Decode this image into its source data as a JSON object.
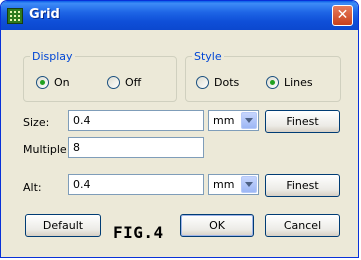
{
  "window": {
    "title": "Grid",
    "close_glyph": "✕"
  },
  "display_group": {
    "label": "Display",
    "options": [
      {
        "label": "On",
        "checked": true
      },
      {
        "label": "Off",
        "checked": false
      }
    ]
  },
  "style_group": {
    "label": "Style",
    "options": [
      {
        "label": "Dots",
        "checked": false
      },
      {
        "label": "Lines",
        "checked": true
      }
    ]
  },
  "size": {
    "label": "Size:",
    "value": "0.4",
    "unit": "mm",
    "button": "Finest"
  },
  "multiple": {
    "label": "Multiple:",
    "value": "8"
  },
  "alt": {
    "label": "Alt:",
    "value": "0.4",
    "unit": "mm",
    "button": "Finest"
  },
  "buttons": {
    "default": "Default",
    "ok": "OK",
    "cancel": "Cancel"
  },
  "annotation": "FIG.4"
}
